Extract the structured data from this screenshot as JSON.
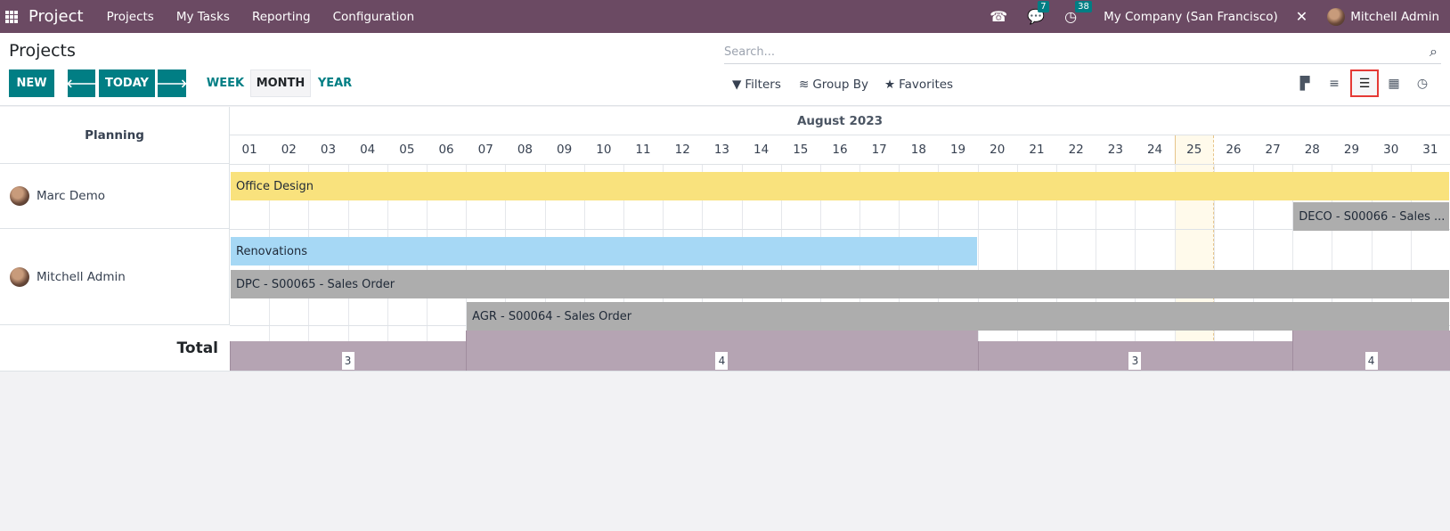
{
  "navbar": {
    "brand": "Project",
    "menu": [
      "Projects",
      "My Tasks",
      "Reporting",
      "Configuration"
    ],
    "messages_badge": "7",
    "activities_badge": "38",
    "company": "My Company (San Francisco)",
    "user": "Mitchell Admin",
    "bg_color": "#6b4a63"
  },
  "control": {
    "title": "Projects",
    "new_label": "NEW",
    "today_label": "TODAY",
    "scales": [
      "WEEK",
      "MONTH",
      "YEAR"
    ],
    "active_scale": "MONTH",
    "search_placeholder": "Search...",
    "filters_label": "Filters",
    "groupby_label": "Group By",
    "favorites_label": "Favorites",
    "views": [
      "kanban",
      "list",
      "gantt",
      "calendar",
      "activity"
    ],
    "active_view": "gantt",
    "accent_color": "#017e84"
  },
  "gantt": {
    "planning_label": "Planning",
    "month_title": "August 2023",
    "days": [
      "01",
      "02",
      "03",
      "04",
      "05",
      "06",
      "07",
      "08",
      "09",
      "10",
      "11",
      "12",
      "13",
      "14",
      "15",
      "16",
      "17",
      "18",
      "19",
      "20",
      "21",
      "22",
      "23",
      "24",
      "25",
      "26",
      "27",
      "28",
      "29",
      "30",
      "31"
    ],
    "today_day": 25,
    "rows": [
      {
        "name": "Marc Demo",
        "pills": [
          {
            "label": "Office Design",
            "start": 1,
            "end": 31,
            "color": "#f9e27d",
            "lane": 0
          },
          {
            "label": "DECO - S00066 - Sales ...",
            "start": 28,
            "end": 31,
            "color": "#adadad",
            "lane": 1
          }
        ]
      },
      {
        "name": "Mitchell Admin",
        "pills": [
          {
            "label": "Renovations",
            "start": 1,
            "end": 19,
            "color": "#a6d8f5",
            "lane": 0
          },
          {
            "label": "DPC - S00065 - Sales Order",
            "start": 1,
            "end": 31,
            "color": "#adadad",
            "lane": 1
          },
          {
            "label": "AGR - S00064 - Sales Order",
            "start": 7,
            "end": 31,
            "color": "#adadad",
            "lane": 2
          }
        ]
      }
    ],
    "total_label": "Total",
    "totals": [
      {
        "start": 1,
        "end": 6,
        "value": 3
      },
      {
        "start": 7,
        "end": 19,
        "value": 4
      },
      {
        "start": 20,
        "end": 27,
        "value": 3
      },
      {
        "start": 28,
        "end": 31,
        "value": 4
      }
    ]
  }
}
